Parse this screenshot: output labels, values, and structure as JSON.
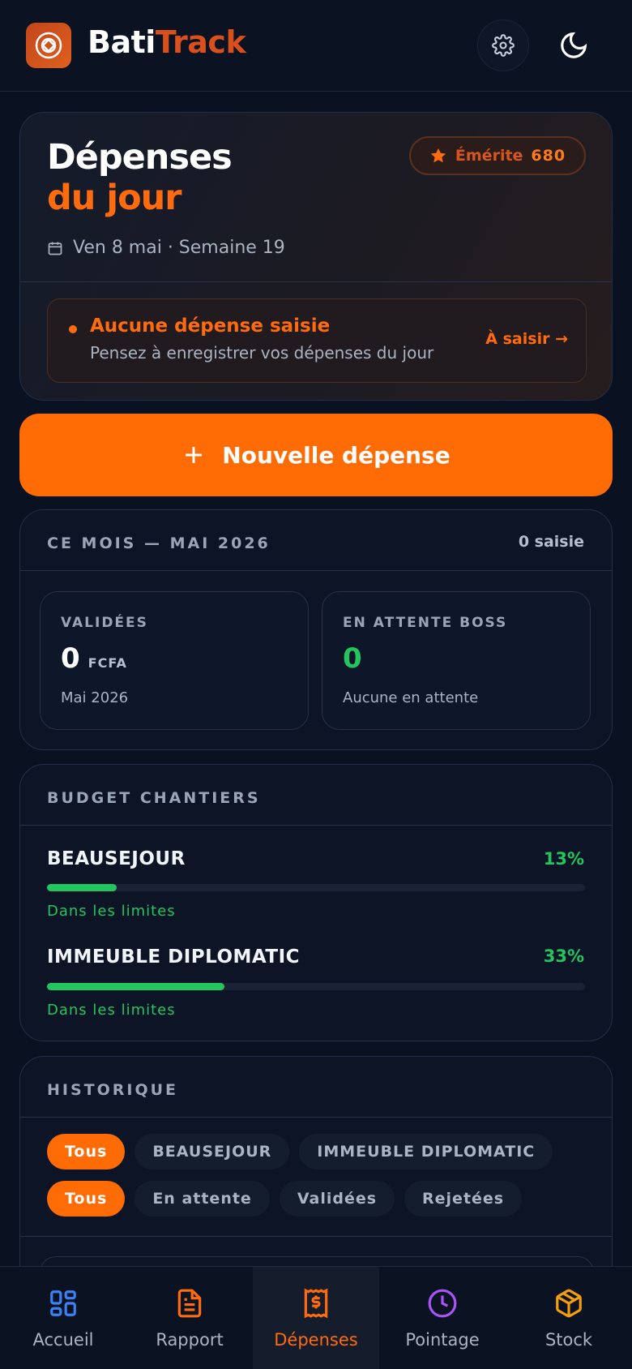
{
  "app": {
    "brand_part1": "Bati",
    "brand_part2": "Track"
  },
  "hero": {
    "title_line1": "Dépenses",
    "title_line2": "du jour",
    "badge_label": "Émérite",
    "badge_value": "680",
    "date_text": "Ven 8 mai · Semaine 19",
    "alert_title": "Aucune dépense saisie",
    "alert_subtitle": "Pensez à enregistrer vos dépenses du jour",
    "alert_action": "À saisir →"
  },
  "cta": {
    "label": "Nouvelle dépense"
  },
  "month": {
    "heading": "CE MOIS — MAI 2026",
    "count": "0 saisie",
    "validated": {
      "label": "VALIDÉES",
      "value": "0",
      "unit": "FCFA",
      "sub": "Mai 2026"
    },
    "pending": {
      "label": "EN ATTENTE BOSS",
      "value": "0",
      "sub": "Aucune en attente"
    }
  },
  "budget": {
    "heading": "BUDGET CHANTIERS",
    "sites": [
      {
        "name": "BEAUSEJOUR",
        "percent_label": "13%",
        "percent": 13,
        "status": "Dans les limites"
      },
      {
        "name": "IMMEUBLE DIPLOMATIC",
        "percent_label": "33%",
        "percent": 33,
        "status": "Dans les limites"
      }
    ]
  },
  "history": {
    "heading": "HISTORIQUE",
    "site_filters": [
      "Tous",
      "BEAUSEJOUR",
      "IMMEUBLE DIPLOMATIC"
    ],
    "status_filters": [
      "Tous",
      "En attente",
      "Validées",
      "Rejetées"
    ]
  },
  "nav": {
    "items": [
      {
        "label": "Accueil",
        "icon": "grid-icon",
        "color": "#3b82f6"
      },
      {
        "label": "Rapport",
        "icon": "document-icon",
        "color": "#ff6b0d"
      },
      {
        "label": "Dépenses",
        "icon": "receipt-dollar-icon",
        "color": "#ff6b0d"
      },
      {
        "label": "Pointage",
        "icon": "clock-icon",
        "color": "#a855f7"
      },
      {
        "label": "Stock",
        "icon": "box-icon",
        "color": "#f59e0b"
      }
    ],
    "active": "Dépenses"
  },
  "colors": {
    "accent": "#ff6b05",
    "success": "#22c55e",
    "background": "#0a1120"
  }
}
